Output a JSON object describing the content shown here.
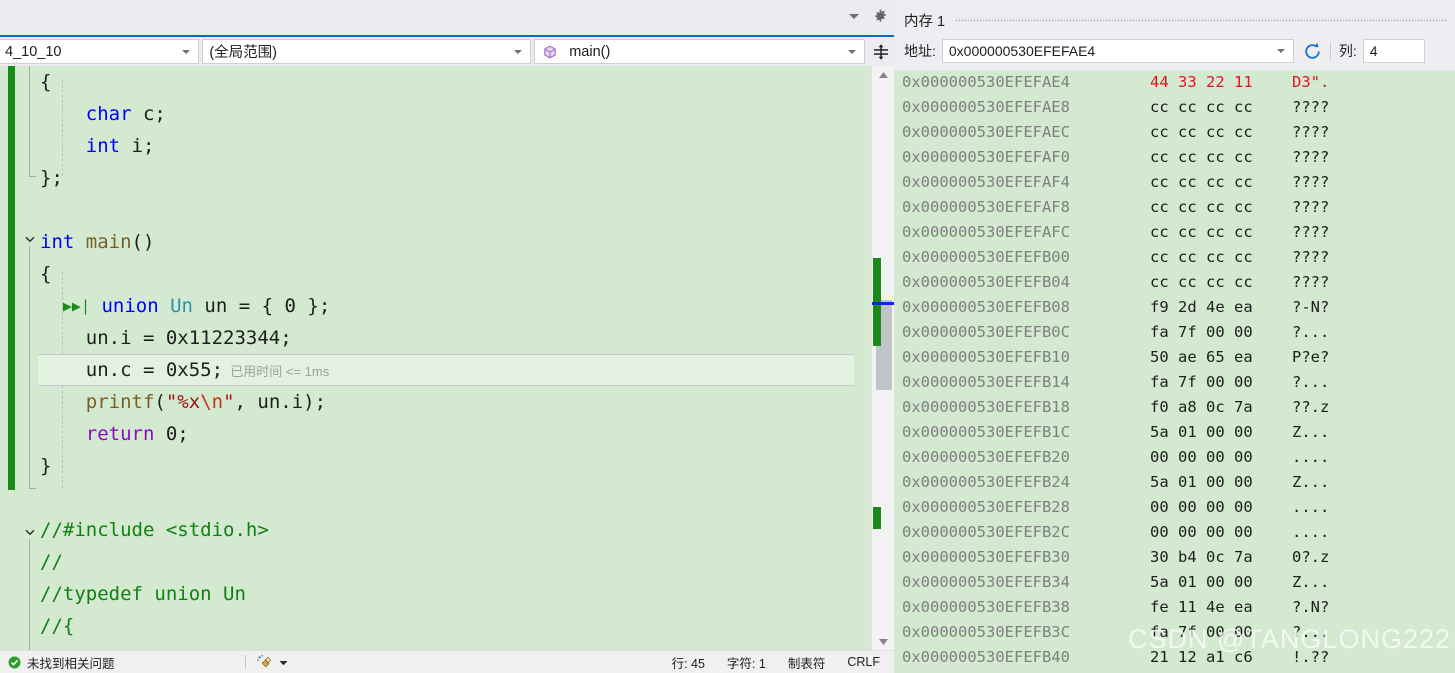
{
  "editor": {
    "nav": {
      "project_dropdown": "4_10_10",
      "scope_dropdown": "(全局范围)",
      "member_dropdown": "main()",
      "member_icon": "method-cube-icon",
      "split_button_icon": "split-view-icon",
      "options_icon": "gear-icon",
      "overflow_icon": "chevron-down-icon"
    },
    "code_lines": [
      {
        "id": "l1",
        "indent": 0,
        "tokens": [
          {
            "t": "{",
            "c": "pl"
          }
        ]
      },
      {
        "id": "l2",
        "indent": 0,
        "tokens": [
          {
            "t": "    ",
            "c": "pl"
          },
          {
            "t": "char",
            "c": "k"
          },
          {
            "t": " c;",
            "c": "pl"
          }
        ]
      },
      {
        "id": "l3",
        "indent": 0,
        "tokens": [
          {
            "t": "    ",
            "c": "pl"
          },
          {
            "t": "int",
            "c": "k"
          },
          {
            "t": " i;",
            "c": "pl"
          }
        ]
      },
      {
        "id": "l4",
        "indent": 0,
        "tokens": [
          {
            "t": "};",
            "c": "pl"
          }
        ]
      },
      {
        "id": "l5",
        "indent": 0,
        "tokens": []
      },
      {
        "id": "l6",
        "indent": 0,
        "tokens": [
          {
            "t": "int",
            "c": "k"
          },
          {
            "t": " ",
            "c": "pl"
          },
          {
            "t": "main",
            "c": "fn"
          },
          {
            "t": "()",
            "c": "pl"
          }
        ]
      },
      {
        "id": "l7",
        "indent": 0,
        "tokens": [
          {
            "t": "{",
            "c": "pl"
          }
        ]
      },
      {
        "id": "l8",
        "indent": 0,
        "tokens": [
          {
            "t": "  ",
            "c": "pl"
          },
          {
            "t": "▶▶|",
            "c": "runarrow"
          },
          {
            "t": " ",
            "c": "pl"
          },
          {
            "t": "union",
            "c": "k"
          },
          {
            "t": " ",
            "c": "pl"
          },
          {
            "t": "Un",
            "c": "ty"
          },
          {
            "t": " un = { 0 };",
            "c": "pl"
          }
        ]
      },
      {
        "id": "l9",
        "indent": 0,
        "tokens": [
          {
            "t": "    un.i = 0x11223344;",
            "c": "pl"
          }
        ]
      },
      {
        "id": "l10",
        "indent": 0,
        "current": true,
        "tokens": [
          {
            "t": "    un.c = 0x55;",
            "c": "pl"
          },
          {
            "t": "  已用时间 <= 1ms",
            "c": "hint"
          }
        ]
      },
      {
        "id": "l11",
        "indent": 0,
        "tokens": [
          {
            "t": "    ",
            "c": "pl"
          },
          {
            "t": "printf",
            "c": "fn"
          },
          {
            "t": "(",
            "c": "pl"
          },
          {
            "t": "\"%x",
            "c": "st"
          },
          {
            "t": "\\n",
            "c": "esc"
          },
          {
            "t": "\"",
            "c": "st"
          },
          {
            "t": ", un.i);",
            "c": "pl"
          }
        ]
      },
      {
        "id": "l12",
        "indent": 0,
        "tokens": [
          {
            "t": "    ",
            "c": "pl"
          },
          {
            "t": "return",
            "c": "kw-purple"
          },
          {
            "t": " 0;",
            "c": "pl"
          }
        ]
      },
      {
        "id": "l13",
        "indent": 0,
        "tokens": [
          {
            "t": "}",
            "c": "pl"
          }
        ]
      },
      {
        "id": "l14",
        "indent": 0,
        "tokens": []
      },
      {
        "id": "l15",
        "indent": 0,
        "tokens": [
          {
            "t": "//#include <stdio.h>",
            "c": "cm"
          }
        ]
      },
      {
        "id": "l16",
        "indent": 0,
        "tokens": [
          {
            "t": "//",
            "c": "cm"
          }
        ]
      },
      {
        "id": "l17",
        "indent": 0,
        "tokens": [
          {
            "t": "//typedef union Un",
            "c": "cm"
          }
        ]
      },
      {
        "id": "l18",
        "indent": 0,
        "tokens": [
          {
            "t": "//{",
            "c": "cm"
          }
        ]
      }
    ],
    "statusbar": {
      "ok_icon": "check-circle-icon",
      "issues": "未找到相关问题",
      "broom_icon": "code-cleanup-icon",
      "broom_caret_icon": "chevron-down-icon",
      "line": "行: 45",
      "char": "字符: 1",
      "tabs": "制表符",
      "eol": "CRLF"
    },
    "scrollbar": {
      "up_arrow_icon": "scroll-up-icon",
      "down_arrow_icon": "scroll-down-icon"
    }
  },
  "memory": {
    "title": "内存 1",
    "address_label": "地址:",
    "address_value": "0x000000530EFEFAE4",
    "address_caret_icon": "chevron-down-icon",
    "refresh_icon": "refresh-icon",
    "columns_label": "列:",
    "columns_value": "4",
    "rows": [
      {
        "addr": "0x000000530EFEFAE4",
        "hex": "44 33 22 11",
        "ascii": "D3\".",
        "highlight": true
      },
      {
        "addr": "0x000000530EFEFAE8",
        "hex": "cc cc cc cc",
        "ascii": "????"
      },
      {
        "addr": "0x000000530EFEFAEC",
        "hex": "cc cc cc cc",
        "ascii": "????"
      },
      {
        "addr": "0x000000530EFEFAF0",
        "hex": "cc cc cc cc",
        "ascii": "????"
      },
      {
        "addr": "0x000000530EFEFAF4",
        "hex": "cc cc cc cc",
        "ascii": "????"
      },
      {
        "addr": "0x000000530EFEFAF8",
        "hex": "cc cc cc cc",
        "ascii": "????"
      },
      {
        "addr": "0x000000530EFEFAFC",
        "hex": "cc cc cc cc",
        "ascii": "????"
      },
      {
        "addr": "0x000000530EFEFB00",
        "hex": "cc cc cc cc",
        "ascii": "????"
      },
      {
        "addr": "0x000000530EFEFB04",
        "hex": "cc cc cc cc",
        "ascii": "????"
      },
      {
        "addr": "0x000000530EFEFB08",
        "hex": "f9 2d 4e ea",
        "ascii": "?-N?"
      },
      {
        "addr": "0x000000530EFEFB0C",
        "hex": "fa 7f 00 00",
        "ascii": "?..."
      },
      {
        "addr": "0x000000530EFEFB10",
        "hex": "50 ae 65 ea",
        "ascii": "P?e?"
      },
      {
        "addr": "0x000000530EFEFB14",
        "hex": "fa 7f 00 00",
        "ascii": "?..."
      },
      {
        "addr": "0x000000530EFEFB18",
        "hex": "f0 a8 0c 7a",
        "ascii": "??.z"
      },
      {
        "addr": "0x000000530EFEFB1C",
        "hex": "5a 01 00 00",
        "ascii": "Z..."
      },
      {
        "addr": "0x000000530EFEFB20",
        "hex": "00 00 00 00",
        "ascii": "...."
      },
      {
        "addr": "0x000000530EFEFB24",
        "hex": "5a 01 00 00",
        "ascii": "Z..."
      },
      {
        "addr": "0x000000530EFEFB28",
        "hex": "00 00 00 00",
        "ascii": "...."
      },
      {
        "addr": "0x000000530EFEFB2C",
        "hex": "00 00 00 00",
        "ascii": "...."
      },
      {
        "addr": "0x000000530EFEFB30",
        "hex": "30 b4 0c 7a",
        "ascii": "0?.z"
      },
      {
        "addr": "0x000000530EFEFB34",
        "hex": "5a 01 00 00",
        "ascii": "Z..."
      },
      {
        "addr": "0x000000530EFEFB38",
        "hex": "fe 11 4e ea",
        "ascii": "?.N?"
      },
      {
        "addr": "0x000000530EFEFB3C",
        "hex": "fa 7f 00 00",
        "ascii": "?..."
      },
      {
        "addr": "0x000000530EFEFB40",
        "hex": "21 12 a1 c6",
        "ascii": "!.??"
      }
    ]
  },
  "watermark": "CSDN @TANGLONG222",
  "colors": {
    "editor_bg": "#d3e9d0",
    "current_line": "#e2f1e0",
    "change_bar": "#1a8b1a",
    "highlight_red": "#e81123",
    "accent_blue": "#0a6cc4"
  }
}
